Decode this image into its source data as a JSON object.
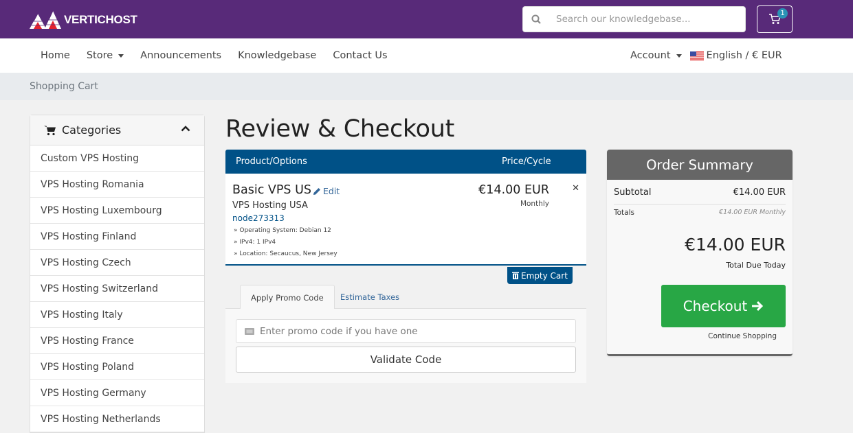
{
  "header": {
    "logo_text": "VERTICHOST",
    "search_placeholder": "Search our knowledgebase...",
    "cart_count": "1",
    "colors": {
      "brand": "#582a79",
      "primary": "#005187",
      "success": "#28a745",
      "badge": "#2a93b5"
    }
  },
  "nav": {
    "items": [
      {
        "label": "Home",
        "dropdown": false
      },
      {
        "label": "Store",
        "dropdown": true
      },
      {
        "label": "Announcements",
        "dropdown": false
      },
      {
        "label": "Knowledgebase",
        "dropdown": false
      },
      {
        "label": "Contact Us",
        "dropdown": false
      }
    ],
    "account_label": "Account",
    "language_label": "English / € EUR",
    "flag_icon": "us-flag-icon"
  },
  "breadcrumb": {
    "current": "Shopping Cart"
  },
  "sidebar": {
    "title": "Categories",
    "items": [
      "Custom VPS Hosting",
      "VPS Hosting Romania",
      "VPS Hosting Luxembourg",
      "VPS Hosting Finland",
      "VPS Hosting Czech",
      "VPS Hosting Switzerland",
      "VPS Hosting Italy",
      "VPS Hosting France",
      "VPS Hosting Poland",
      "VPS Hosting Germany",
      "VPS Hosting Netherlands"
    ]
  },
  "main": {
    "title": "Review & Checkout",
    "table": {
      "col_product": "Product/Options",
      "col_price": "Price/Cycle",
      "item": {
        "name": "Basic VPS US",
        "edit_label": "Edit",
        "group": "VPS Hosting USA",
        "domain": "node273313",
        "options": [
          "» Operating System: Debian 12",
          "» IPv4: 1 IPv4",
          "» Location: Secaucus, New Jersey"
        ],
        "price": "€14.00 EUR",
        "cycle": "Monthly"
      }
    },
    "empty_cart_label": "Empty Cart",
    "tabs": [
      "Apply Promo Code",
      "Estimate Taxes"
    ],
    "promo_placeholder": "Enter promo code if you have one",
    "validate_label": "Validate Code"
  },
  "summary": {
    "title": "Order Summary",
    "subtotal_label": "Subtotal",
    "subtotal_value": "€14.00 EUR",
    "totals_label": "Totals",
    "totals_value": "€14.00 EUR Monthly",
    "total_due": "€14.00 EUR",
    "total_due_label": "Total Due Today",
    "checkout_label": "Checkout",
    "continue_label": "Continue Shopping"
  }
}
